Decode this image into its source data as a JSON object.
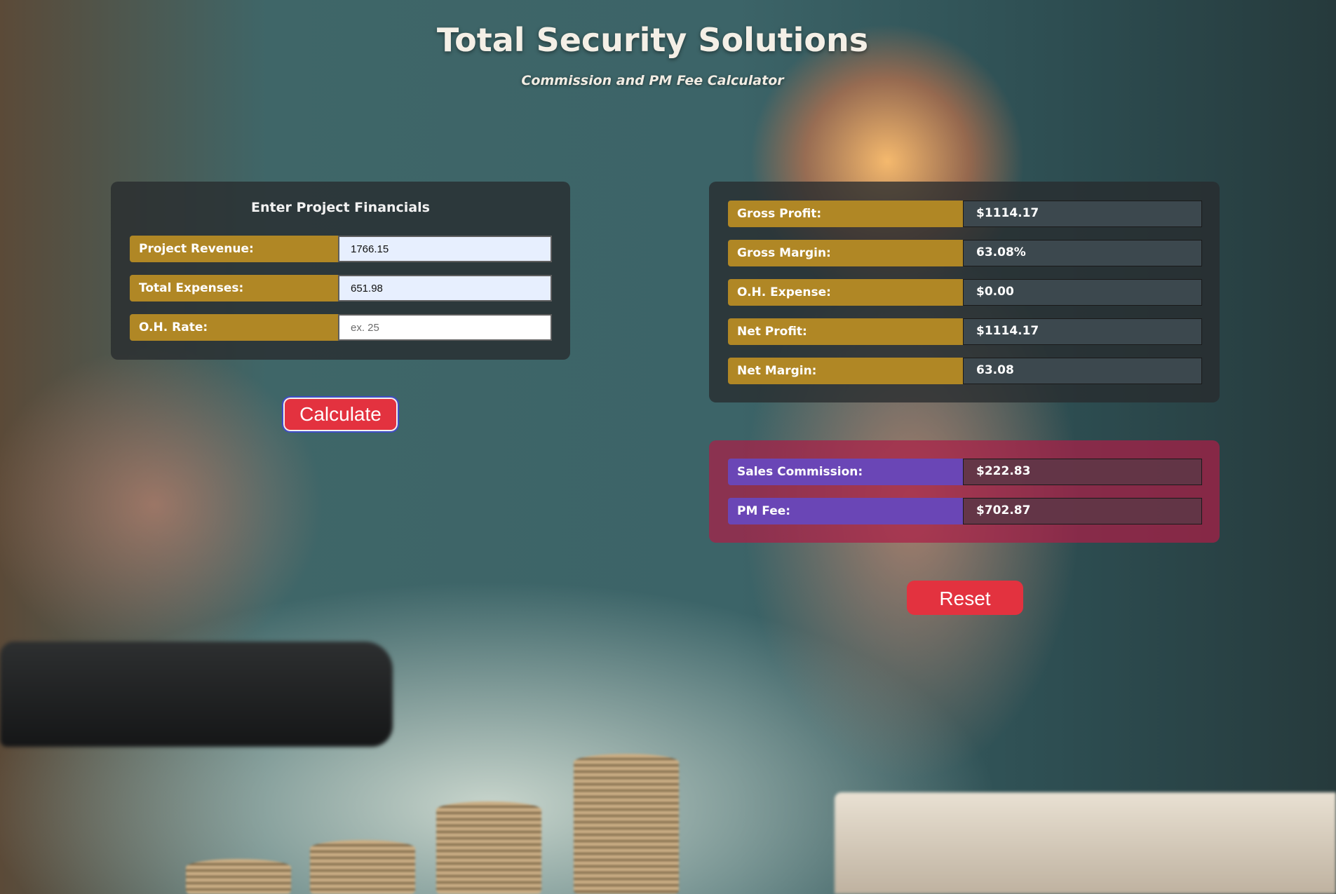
{
  "header": {
    "title": "Total Security Solutions",
    "subtitle": "Commission and PM Fee Calculator"
  },
  "input_panel": {
    "heading": "Enter Project Financials",
    "fields": [
      {
        "label": "Project Revenue:",
        "value": "1766.15",
        "placeholder": ""
      },
      {
        "label": "Total Expenses:",
        "value": "651.98",
        "placeholder": ""
      },
      {
        "label": "O.H. Rate:",
        "value": "",
        "placeholder": "ex. 25"
      }
    ],
    "calculate_label": "Calculate"
  },
  "results_panel": {
    "rows": [
      {
        "label": "Gross Profit:",
        "value": "$1114.17"
      },
      {
        "label": "Gross Margin:",
        "value": "63.08%"
      },
      {
        "label": "O.H. Expense:",
        "value": "$0.00"
      },
      {
        "label": "Net Profit:",
        "value": "$1114.17"
      },
      {
        "label": "Net Margin:",
        "value": "63.08"
      }
    ]
  },
  "commission_panel": {
    "rows": [
      {
        "label": "Sales Commission:",
        "value": "$222.83"
      },
      {
        "label": "PM Fee:",
        "value": "$702.87"
      }
    ]
  },
  "reset_label": "Reset",
  "colors": {
    "label_gold": "#b08725",
    "label_purple": "#6a46b6",
    "button_red": "#e3323f",
    "commission_panel": "#aa1e46"
  }
}
